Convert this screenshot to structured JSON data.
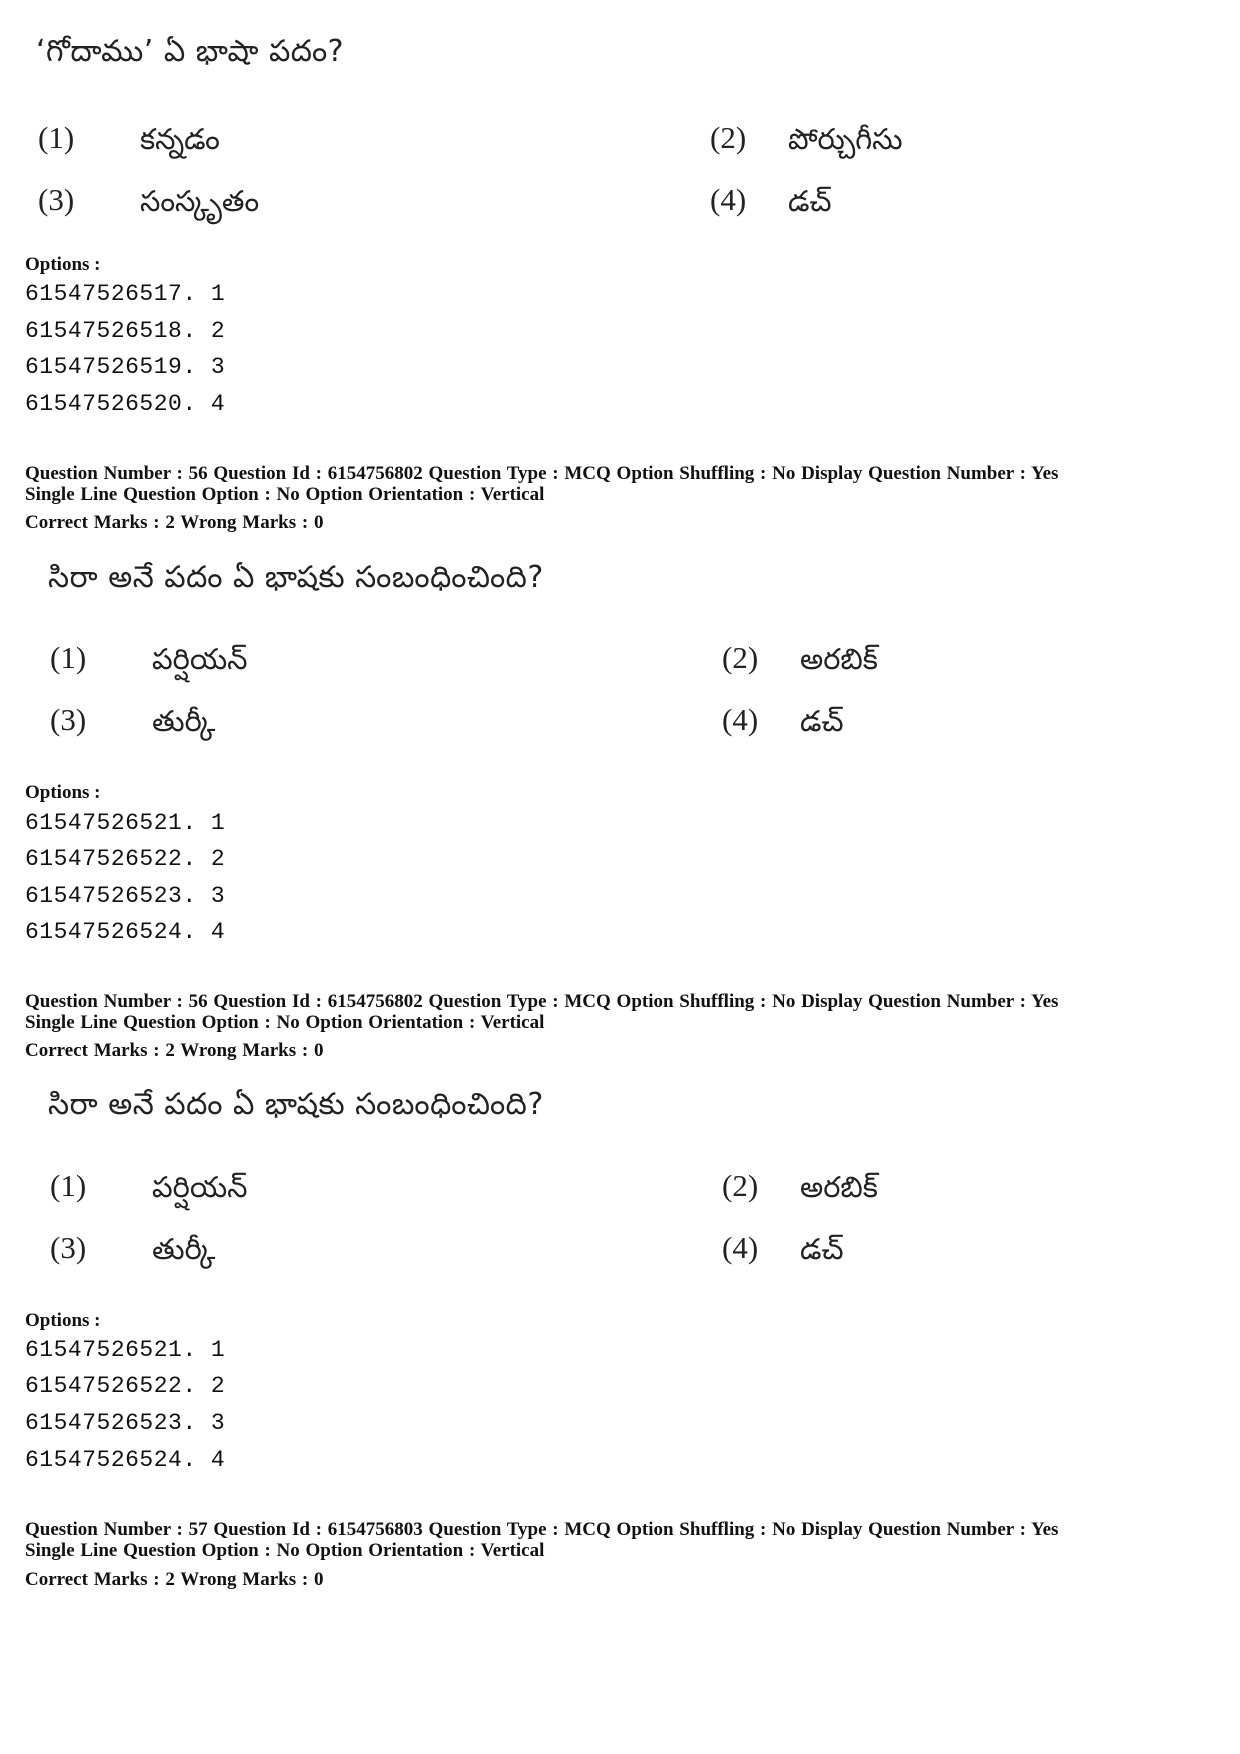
{
  "blocks": [
    {
      "question_text": "‘గోదాము’ ఏ భాషా పదం?",
      "choices": [
        {
          "num": "(1)",
          "text": "కన్నడం"
        },
        {
          "num": "(2)",
          "text": "పోర్చుగీసు"
        },
        {
          "num": "(3)",
          "text": "సంస్కృతం"
        },
        {
          "num": "(4)",
          "text": "డచ్"
        }
      ],
      "options_label": "Options :",
      "option_ids": [
        "61547526517. 1",
        "61547526518. 2",
        "61547526519. 3",
        "61547526520. 4"
      ]
    },
    {
      "header_line1": "Question Number : 56  Question Id : 6154756802  Question Type : MCQ  Option Shuffling : No  Display Question Number : Yes",
      "header_line2": "Single Line Question Option : No  Option Orientation : Vertical",
      "marks_line": "Correct Marks : 2  Wrong Marks : 0",
      "question_text": "సిరా అనే పదం ఏ భాషకు సంబంధించింది?",
      "choices": [
        {
          "num": "(1)",
          "text": "పర్షియన్"
        },
        {
          "num": "(2)",
          "text": "అరబిక్"
        },
        {
          "num": "(3)",
          "text": "తుర్కీ"
        },
        {
          "num": "(4)",
          "text": "డచ్"
        }
      ],
      "options_label": "Options :",
      "option_ids": [
        "61547526521. 1",
        "61547526522. 2",
        "61547526523. 3",
        "61547526524. 4"
      ]
    },
    {
      "header_line1": "Question Number : 56  Question Id : 6154756802  Question Type : MCQ  Option Shuffling : No  Display Question Number : Yes",
      "header_line2": "Single Line Question Option : No  Option Orientation : Vertical",
      "marks_line": "Correct Marks : 2  Wrong Marks : 0",
      "question_text": "సిరా అనే పదం ఏ భాషకు సంబంధించింది?",
      "choices": [
        {
          "num": "(1)",
          "text": "పర్షియన్"
        },
        {
          "num": "(2)",
          "text": "అరబిక్"
        },
        {
          "num": "(3)",
          "text": "తుర్కీ"
        },
        {
          "num": "(4)",
          "text": "డచ్"
        }
      ],
      "options_label": "Options :",
      "option_ids": [
        "61547526521. 1",
        "61547526522. 2",
        "61547526523. 3",
        "61547526524. 4"
      ]
    },
    {
      "header_line1": "Question Number : 57  Question Id : 6154756803  Question Type : MCQ  Option Shuffling : No  Display Question Number : Yes",
      "header_line2": "Single Line Question Option : No  Option Orientation : Vertical",
      "marks_line": "Correct Marks : 2  Wrong Marks : 0"
    }
  ]
}
